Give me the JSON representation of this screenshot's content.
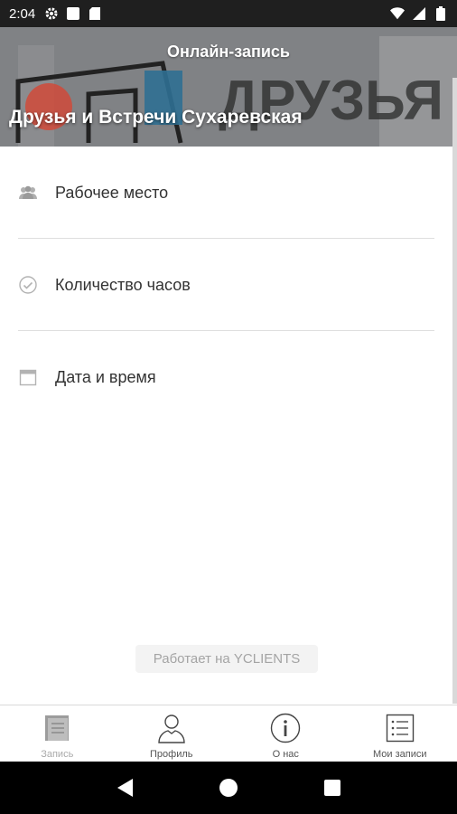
{
  "status_bar": {
    "time": "2:04"
  },
  "header": {
    "title": "Онлайн-запись",
    "company_name": "Друзья и Встречи Сухаревская"
  },
  "menu": {
    "items": [
      {
        "label": "Рабочее место",
        "icon": "people-icon"
      },
      {
        "label": "Количество часов",
        "icon": "check-circle-icon"
      },
      {
        "label": "Дата и время",
        "icon": "calendar-icon"
      }
    ]
  },
  "powered_by": "Работает на YCLIENTS",
  "tabs": [
    {
      "label": "Запись",
      "icon": "booking-icon",
      "active": true
    },
    {
      "label": "Профиль",
      "icon": "profile-icon",
      "active": false
    },
    {
      "label": "О нас",
      "icon": "info-icon",
      "active": false
    },
    {
      "label": "Мои записи",
      "icon": "list-icon",
      "active": false
    }
  ],
  "colors": {
    "status_bar_bg": "#1f1f1f",
    "header_bg": "#7d7f82",
    "text": "#333333",
    "muted": "#a4a4a4"
  }
}
